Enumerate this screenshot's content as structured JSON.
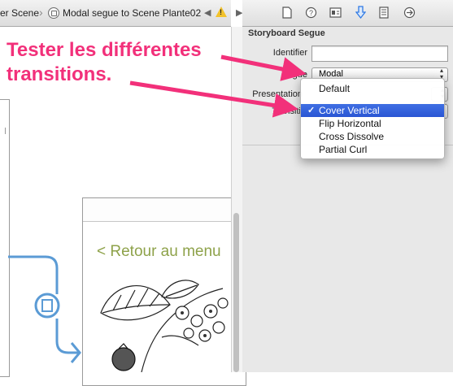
{
  "jumpbar": {
    "crumb_scene": "er Scene",
    "crumb_segue": "Modal segue to Scene Plante02",
    "back_symbol": "◀",
    "forward_symbol": "▶",
    "warning_mark": "!"
  },
  "inspector": {
    "tabs": [
      "file-icon",
      "help-icon",
      "identity-icon",
      "attributes-icon",
      "size-icon",
      "connections-icon"
    ],
    "section_title": "Storyboard Segue",
    "identifier_label": "Identifier",
    "identifier_value": "",
    "segue_label": "egue",
    "segue_value": "Modal",
    "presentation_label": "Presentation",
    "transition_label": "Transiti"
  },
  "menu": {
    "items": [
      "Default",
      "Cover Vertical",
      "Flip Horizontal",
      "Cross Dissolve",
      "Partial Curl"
    ],
    "selected": "Cover Vertical",
    "check": "✓"
  },
  "canvas": {
    "back_button": "< Retour au menu"
  },
  "annotation": {
    "line1": "Tester les différentes",
    "line2": "transitions."
  },
  "colors": {
    "annotation": "#f2307a",
    "selection": "#2a56d4",
    "segue_line": "#5b9bd5",
    "back_button_text": "#8ea24a",
    "warning": "#f2c22c"
  }
}
